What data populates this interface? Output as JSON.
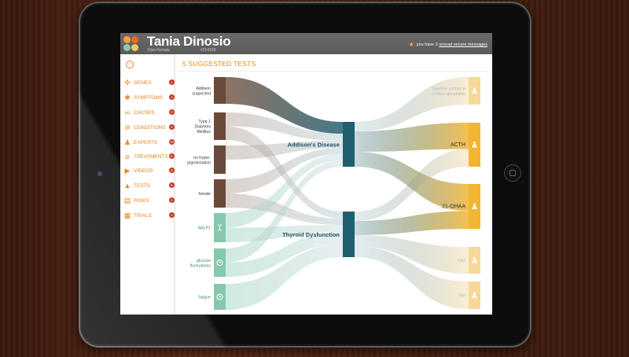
{
  "header": {
    "patient_name": "Tania Dinosio",
    "patient_info": "10yo Female",
    "patient_id": "#314159",
    "message_prefix": "you have 3 ",
    "message_link": "unread secure messages"
  },
  "sidebar": {
    "items": [
      {
        "label": "GENES",
        "count": "1",
        "icon": "dna-icon",
        "glyph": "✣"
      },
      {
        "label": "SYMPTOMS",
        "count": "4",
        "icon": "body-icon",
        "glyph": "✱"
      },
      {
        "label": "CAUSES",
        "count": "2",
        "icon": "link-icon",
        "glyph": "∞"
      },
      {
        "label": "CONDITIONS",
        "count": "2",
        "icon": "bandage-icon",
        "glyph": "⊘"
      },
      {
        "label": "EXPERTS",
        "count": "10",
        "icon": "people-icon",
        "glyph": "♟"
      },
      {
        "label": "TREATMENTS",
        "count": "5",
        "icon": "pill-icon",
        "glyph": "⌀"
      },
      {
        "label": "VIDEOS",
        "count": "8",
        "icon": "video-icon",
        "glyph": "▶"
      },
      {
        "label": "TESTS",
        "count": "5",
        "icon": "flask-icon",
        "glyph": "▲"
      },
      {
        "label": "RISKS",
        "count": "1",
        "icon": "chart-icon",
        "glyph": "▤"
      },
      {
        "label": "TRIALS",
        "count": "2",
        "icon": "clipboard-icon",
        "glyph": "▦"
      }
    ]
  },
  "main": {
    "title": "5 SUGGESTED TESTS"
  },
  "sankey": {
    "sources": [
      {
        "label": "Addison\nsuspected",
        "kind": "finding",
        "icon": ""
      },
      {
        "label": "Type 1\nDiabetes\nMellitus",
        "kind": "finding",
        "icon": ""
      },
      {
        "label": "no hyper-\npigmentation",
        "kind": "finding",
        "icon": ""
      },
      {
        "label": "female",
        "kind": "finding",
        "icon": ""
      },
      {
        "label": "NALP1",
        "kind": "gene",
        "icon": "dna-icon"
      },
      {
        "label": "glucose\nfluctuations",
        "kind": "symptom",
        "icon": "clock-icon"
      },
      {
        "label": "fatigue",
        "kind": "symptom",
        "icon": "clock-icon"
      }
    ],
    "conditions": [
      {
        "label": "Addison's Disease"
      },
      {
        "label": "Thyroid Dysfunction"
      }
    ],
    "tests": [
      {
        "label": "baseline cortisol &\ncortisol stimulation",
        "emphasis": "light",
        "icon": "flask-icon"
      },
      {
        "label": "ACTH",
        "emphasis": "strong",
        "icon": "flask-icon"
      },
      {
        "label": "21-OHAA",
        "emphasis": "strong",
        "icon": "flask-icon"
      },
      {
        "label": "TSO",
        "emphasis": "light",
        "icon": "flask-icon"
      },
      {
        "label": "TSH",
        "emphasis": "light",
        "icon": "flask-icon"
      }
    ],
    "colors": {
      "finding": "#6b4a3a",
      "gene": "#86c8ac",
      "symptom": "#86c8ac",
      "condition": "#1f5f70",
      "test_strong": "#f2b534",
      "test_light": "#f7d79a",
      "accent": "#e88a1a",
      "badge": "#c8371d"
    }
  }
}
